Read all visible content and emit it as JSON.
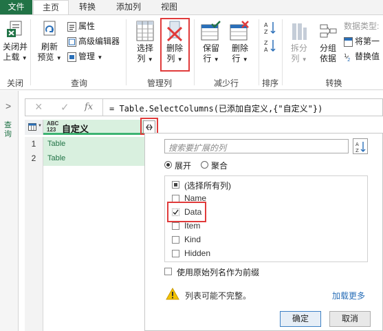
{
  "tabs": {
    "file": "文件",
    "home": "主页",
    "transform": "转换",
    "add_column": "添加列",
    "view": "视图"
  },
  "ribbon": {
    "close_load": [
      "关闭并",
      "上载"
    ],
    "refresh": [
      "刷新",
      "预览"
    ],
    "properties": "属性",
    "advanced_editor": "高级编辑器",
    "manage": "管理",
    "choose_columns": [
      "选择",
      "列"
    ],
    "remove_columns": [
      "删除",
      "列"
    ],
    "keep_rows": [
      "保留",
      "行"
    ],
    "remove_rows": [
      "删除",
      "行"
    ],
    "split_column": [
      "拆分",
      "列"
    ],
    "group_by": [
      "分组",
      "依据"
    ],
    "data_type": "数据类型:",
    "use_first_row": "将第一",
    "replace_values": "替换值",
    "groups": {
      "close": "关闭",
      "query": "查询",
      "manage_columns": "管理列",
      "reduce_rows": "减少行",
      "sort": "排序",
      "transform": "转换"
    },
    "colors": {
      "accent": "#217346",
      "highlight": "#e03a3a"
    }
  },
  "left_nav": {
    "label": "查询",
    "chevron": ">"
  },
  "formula": {
    "cancel_icon": "×",
    "check_icon": "✓",
    "fx": "fx",
    "text": "= Table.SelectColumns(已添加自定义,{\"自定义\"})"
  },
  "grid": {
    "type_label_top": "ABC",
    "type_label_bottom": "123",
    "column_name": "自定义",
    "rows": [
      {
        "num": "1",
        "value": "Table"
      },
      {
        "num": "2",
        "value": "Table"
      }
    ]
  },
  "popup": {
    "search_placeholder": "搜索要扩展的列",
    "expand_label": "展开",
    "aggregate_label": "聚合",
    "select_all": "(选择所有列)",
    "columns": [
      {
        "name": "Name",
        "checked": false
      },
      {
        "name": "Data",
        "checked": true
      },
      {
        "name": "Item",
        "checked": false
      },
      {
        "name": "Kind",
        "checked": false
      },
      {
        "name": "Hidden",
        "checked": false
      }
    ],
    "use_prefix": "使用原始列名作为前缀",
    "warning": "列表可能不完整。",
    "load_more": "加载更多",
    "ok": "确定",
    "cancel": "取消"
  }
}
